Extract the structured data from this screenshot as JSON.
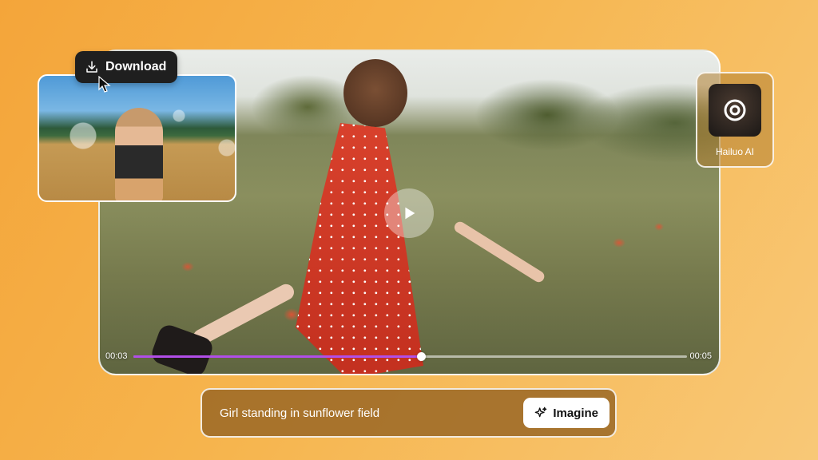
{
  "player": {
    "current_time": "00:03",
    "total_time": "00:05",
    "progress": 0.52,
    "play_icon": "play-icon",
    "progress_color": "#b14ee8"
  },
  "thumbnail": {
    "download_label": "Download",
    "download_icon": "download-icon",
    "cursor_icon": "cursor-icon"
  },
  "model": {
    "name": "Hailuo AI",
    "logo_icon": "hailuo-logo-icon"
  },
  "prompt": {
    "text": "Girl standing in sunflower field",
    "button_label": "Imagine",
    "button_icon": "sparkle-icon"
  },
  "colors": {
    "background": "#f6b54e",
    "accent": "#b14ee8"
  }
}
